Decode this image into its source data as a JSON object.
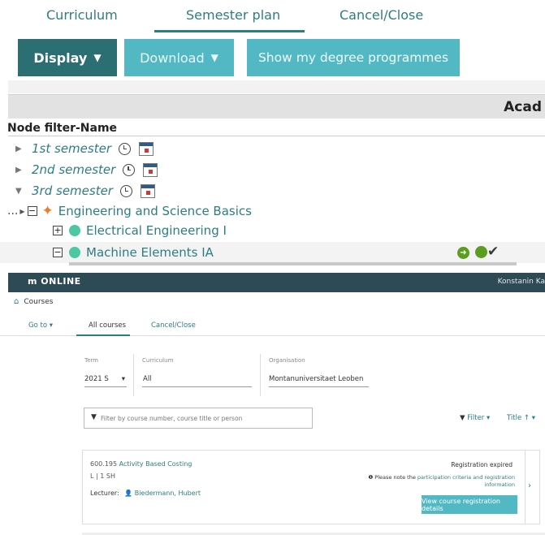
{
  "top_tabs": [
    "Curriculum",
    "Semester plan",
    "Cancel/Close"
  ],
  "buttons": {
    "display": "Display",
    "download": "Download",
    "degree": "Show my degree programmes"
  },
  "acad_header": "Acad",
  "node_filter": "Node filter-Name",
  "semesters": [
    "1st semester",
    "2nd semester",
    "3rd semester"
  ],
  "tree_prefix": "...",
  "engineering_node": "Engineering and Science Basics",
  "electrical": "Electrical Engineering I",
  "machine": "Machine Elements IA",
  "m_online": {
    "logo": "m ONLINE",
    "user": "Konstanin Ka",
    "courses": "Courses",
    "nav": {
      "goto": "Go to",
      "all_courses": "All courses",
      "cancel": "Cancel/Close"
    },
    "filters": {
      "term_label": "Term",
      "term_value": "2021 S",
      "curriculum_label": "Curriculum",
      "curriculum_value": "All",
      "organisation_label": "Organisation",
      "organisation_value": "Montanuniversitaet Leoben"
    },
    "search_placeholder": "Filter by course number, course title or person",
    "filter_btn": "Filter",
    "title_sort": "Title",
    "card": {
      "number": "600.195",
      "title": "Activity Based Costing",
      "type": "L | 1 SH",
      "lecturer_label": "Lecturer:",
      "lecturer": "Biedermann, Hubert",
      "status": "Registration expired",
      "note_prefix": "Please note the",
      "note_link": "participation criteria and registration information",
      "button": "View course registration details"
    }
  }
}
